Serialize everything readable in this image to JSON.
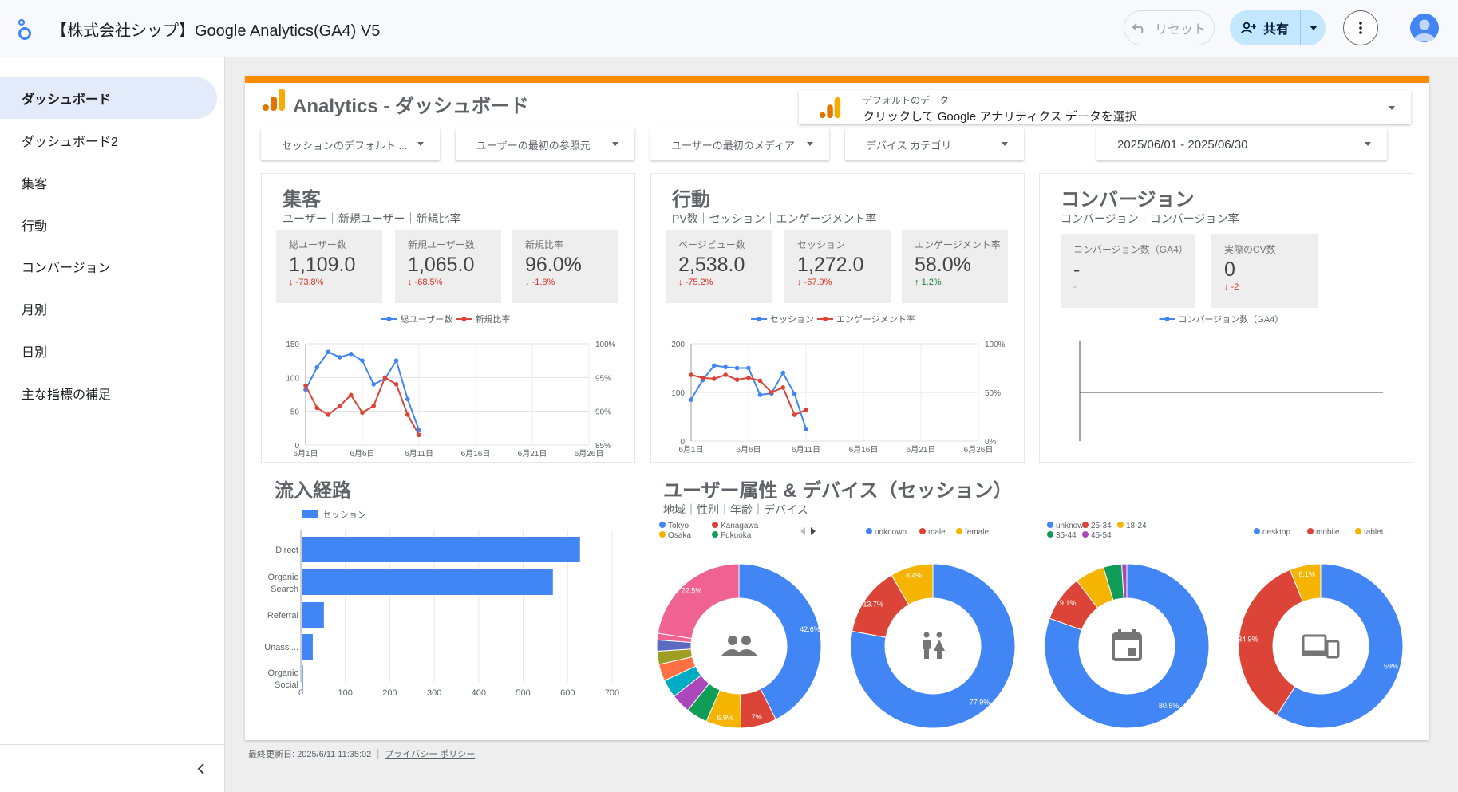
{
  "header": {
    "title": "【株式会社シップ】Google Analytics(GA4) V5",
    "reset_label": "リセット",
    "share_label": "共有"
  },
  "sidebar": {
    "items": [
      {
        "label": "ダッシュボード",
        "active": true
      },
      {
        "label": "ダッシュボード2"
      },
      {
        "label": "集客"
      },
      {
        "label": "行動"
      },
      {
        "label": "コンバージョン"
      },
      {
        "label": "月別"
      },
      {
        "label": "日別"
      },
      {
        "label": "主な指標の補足"
      }
    ]
  },
  "report": {
    "title": "Analytics - ダッシュボード",
    "data_selector": {
      "label": "デフォルトのデータ",
      "value": "クリックして Google アナリティクス データを選択"
    },
    "filters": [
      "セッションのデフォルト ...",
      "ユーザーの最初の参照元",
      "ユーザーの最初のメディア",
      "デバイス カテゴリ"
    ],
    "date_range": "2025/06/01 - 2025/06/30",
    "acquisition": {
      "title": "集客",
      "subtitle": "ユーザー｜新規ユーザー｜新規比率",
      "kpis": [
        {
          "label": "総ユーザー数",
          "value": "1,109.0",
          "delta": "-73.8%",
          "direction": "down"
        },
        {
          "label": "新規ユーザー数",
          "value": "1,065.0",
          "delta": "-68.5%",
          "direction": "down"
        },
        {
          "label": "新規比率",
          "value": "96.0%",
          "delta": "-1.8%",
          "direction": "down"
        }
      ]
    },
    "behavior": {
      "title": "行動",
      "subtitle": "PV数｜セッション｜エンゲージメント率",
      "kpis": [
        {
          "label": "ページビュー数",
          "value": "2,538.0",
          "delta": "-75.2%",
          "direction": "down"
        },
        {
          "label": "セッション",
          "value": "1,272.0",
          "delta": "-67.9%",
          "direction": "down"
        },
        {
          "label": "エンゲージメント率",
          "value": "58.0%",
          "delta": "1.2%",
          "direction": "up"
        }
      ]
    },
    "conversion": {
      "title": "コンバージョン",
      "subtitle": "コンバージョン｜コンバージョン率",
      "kpis": [
        {
          "label": "コンバージョン数（GA4）",
          "value": "-",
          "delta": "-"
        },
        {
          "label": "実際のCV数",
          "value": "0",
          "delta": "-2",
          "direction": "down"
        }
      ]
    },
    "traffic": {
      "title": "流入経路"
    },
    "demographics": {
      "title": "ユーザー属性 & デバイス（セッション）",
      "subtitle": "地域｜性別｜年齢｜デバイス"
    },
    "footer": {
      "updated": "最終更新日: 2025/6/11 11:35:02",
      "privacy": "プライバシー ポリシー"
    }
  },
  "colors": {
    "blue": "#4285f4",
    "red": "#db4437",
    "yellow": "#f4b400",
    "green": "#0f9d58",
    "purple": "#ab47bc",
    "orange": "#fb8c00",
    "pink": "#f06292",
    "teal": "#00acc1"
  },
  "chart_data": [
    {
      "id": "acquisition-line",
      "type": "line",
      "x_tick_labels": [
        "6月1日",
        "6月6日",
        "6月11日",
        "6月16日",
        "6月21日",
        "6月26日"
      ],
      "x_days": [
        1,
        2,
        3,
        4,
        5,
        6,
        7,
        8,
        9,
        10,
        11
      ],
      "series": [
        {
          "name": "総ユーザー数",
          "axis": "left",
          "values": [
            82,
            115,
            138,
            130,
            135,
            125,
            90,
            98,
            125,
            68,
            22
          ]
        },
        {
          "name": "新規比率",
          "axis": "right",
          "values": [
            93.8,
            90.5,
            89.5,
            90.8,
            92.4,
            89.8,
            90.8,
            95,
            94,
            89.5,
            86.5
          ]
        }
      ],
      "y_left": {
        "ticks": [
          0,
          50,
          100,
          150
        ],
        "range": [
          0,
          150
        ]
      },
      "y_right": {
        "ticks": [
          "85%",
          "90%",
          "95%",
          "100%"
        ],
        "range": [
          85,
          100
        ]
      },
      "legend_position": "top"
    },
    {
      "id": "behavior-line",
      "type": "line",
      "x_tick_labels": [
        "6月1日",
        "6月6日",
        "6月11日",
        "6月16日",
        "6月21日",
        "6月26日"
      ],
      "x_days": [
        1,
        2,
        3,
        4,
        5,
        6,
        7,
        8,
        9,
        10,
        11
      ],
      "series": [
        {
          "name": "セッション",
          "axis": "left",
          "values": [
            85,
            125,
            155,
            152,
            150,
            150,
            95,
            98,
            140,
            97,
            25
          ]
        },
        {
          "name": "エンゲージメント率",
          "axis": "right",
          "values": [
            68,
            65,
            64,
            68,
            63,
            65,
            62,
            50,
            55,
            27,
            32
          ]
        }
      ],
      "y_left": {
        "ticks": [
          0,
          100,
          200
        ],
        "range": [
          0,
          200
        ]
      },
      "y_right": {
        "ticks": [
          "0%",
          "50%",
          "100%"
        ],
        "range": [
          0,
          100
        ]
      },
      "legend_position": "top"
    },
    {
      "id": "conversion-line",
      "type": "line",
      "series": [
        {
          "name": "コンバージョン数（GA4）",
          "values": []
        }
      ],
      "legend_position": "top"
    },
    {
      "id": "traffic-bar",
      "type": "bar",
      "orientation": "horizontal",
      "categories": [
        [
          "Direct"
        ],
        [
          "Organic",
          "Search"
        ],
        [
          "Referral"
        ],
        [
          "Unassi..."
        ],
        [
          "Organic",
          "Social"
        ]
      ],
      "series": [
        {
          "name": "セッション",
          "values": [
            626,
            565,
            50,
            25,
            3
          ]
        }
      ],
      "x_ticks": [
        0,
        100,
        200,
        300,
        400,
        500,
        600,
        700
      ],
      "xlim": [
        0,
        700
      ],
      "legend_position": "top"
    },
    {
      "id": "region-donut",
      "type": "pie",
      "legend": [
        {
          "name": "Tokyo",
          "color": "#4285f4"
        },
        {
          "name": "Kanagawa",
          "color": "#db4437"
        },
        {
          "name": "Osaka",
          "color": "#f4b400"
        },
        {
          "name": "Fukuoka",
          "color": "#0f9d58"
        }
      ],
      "slices": [
        {
          "value": 42.6,
          "color": "#4285f4",
          "label": "42.6%"
        },
        {
          "value": 7,
          "color": "#db4437",
          "label": "7%"
        },
        {
          "value": 6.9,
          "color": "#f4b400",
          "label": "6.9%"
        },
        {
          "value": 4.2,
          "color": "#0f9d58"
        },
        {
          "value": 3.8,
          "color": "#ab47bc"
        },
        {
          "value": 3.6,
          "color": "#00acc1"
        },
        {
          "value": 3.3,
          "color": "#ff7043"
        },
        {
          "value": 2.6,
          "color": "#9e9d24"
        },
        {
          "value": 2.2,
          "color": "#5c6bc0"
        },
        {
          "value": 1.3,
          "color": "#f06292"
        },
        {
          "value": 22.5,
          "color": "#f06292",
          "label": "22.5%"
        }
      ],
      "icon": "people-icon"
    },
    {
      "id": "gender-donut",
      "type": "pie",
      "legend": [
        {
          "name": "unknown",
          "color": "#4285f4"
        },
        {
          "name": "male",
          "color": "#db4437"
        },
        {
          "name": "female",
          "color": "#f4b400"
        }
      ],
      "slices": [
        {
          "value": 77.9,
          "color": "#4285f4",
          "label": "77.9%"
        },
        {
          "value": 13.7,
          "color": "#db4437",
          "label": "13.7%"
        },
        {
          "value": 8.4,
          "color": "#f4b400",
          "label": "8.4%"
        }
      ],
      "icon": "wc-icon"
    },
    {
      "id": "age-donut",
      "type": "pie",
      "legend": [
        {
          "name": "unknown",
          "color": "#4285f4"
        },
        {
          "name": "25-34",
          "color": "#db4437"
        },
        {
          "name": "18-24",
          "color": "#f4b400"
        },
        {
          "name": "35-44",
          "color": "#0f9d58"
        },
        {
          "name": "45-54",
          "color": "#ab47bc"
        }
      ],
      "slices": [
        {
          "value": 80.5,
          "color": "#4285f4",
          "label": "80.5%"
        },
        {
          "value": 9.1,
          "color": "#db4437",
          "label": "9.1%"
        },
        {
          "value": 5.8,
          "color": "#f4b400"
        },
        {
          "value": 3.6,
          "color": "#0f9d58"
        },
        {
          "value": 1.0,
          "color": "#ab47bc"
        }
      ],
      "icon": "calendar-icon"
    },
    {
      "id": "device-donut",
      "type": "pie",
      "legend": [
        {
          "name": "desktop",
          "color": "#4285f4"
        },
        {
          "name": "mobile",
          "color": "#db4437"
        },
        {
          "name": "tablet",
          "color": "#f4b400"
        }
      ],
      "slices": [
        {
          "value": 59,
          "color": "#4285f4",
          "label": "59%"
        },
        {
          "value": 34.9,
          "color": "#db4437",
          "label": "34.9%"
        },
        {
          "value": 6.1,
          "color": "#f4b400",
          "label": "6.1%"
        }
      ],
      "icon": "devices-icon"
    }
  ]
}
